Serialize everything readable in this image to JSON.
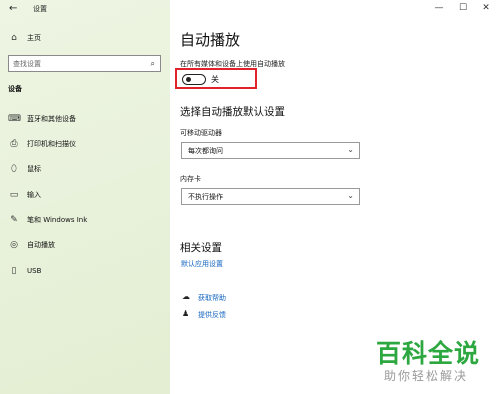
{
  "window": {
    "back_icon": "←",
    "title": "设置",
    "min": "—",
    "max": "☐",
    "close": "✕"
  },
  "sidebar": {
    "home_label": "主页",
    "search_placeholder": "查找设置",
    "section": "设备",
    "items": [
      {
        "icon": "bluetooth-icon",
        "glyph": "⌨",
        "label": "蓝牙和其他设备"
      },
      {
        "icon": "printer-icon",
        "glyph": "⎙",
        "label": "打印机和扫描仪"
      },
      {
        "icon": "mouse-icon",
        "glyph": "⬯",
        "label": "鼠标"
      },
      {
        "icon": "keyboard-icon",
        "glyph": "▭",
        "label": "输入"
      },
      {
        "icon": "pen-icon",
        "glyph": "✎",
        "label": "笔和 Windows Ink"
      },
      {
        "icon": "autoplay-icon",
        "glyph": "◎",
        "label": "自动播放"
      },
      {
        "icon": "usb-icon",
        "glyph": "▯",
        "label": "USB"
      }
    ]
  },
  "main": {
    "title": "自动播放",
    "toggle_desc": "在所有媒体和设备上使用自动播放",
    "toggle_state": "关",
    "defaults_heading": "选择自动播放默认设置",
    "removable_label": "可移动驱动器",
    "removable_value": "每次都询问",
    "memory_label": "内存卡",
    "memory_value": "不执行操作",
    "related_heading": "相关设置",
    "related_link": "默认应用设置",
    "help_link": "获取帮助",
    "feedback_link": "提供反馈"
  },
  "watermark": {
    "main": "百科全说",
    "sub": "助你轻松解决"
  }
}
